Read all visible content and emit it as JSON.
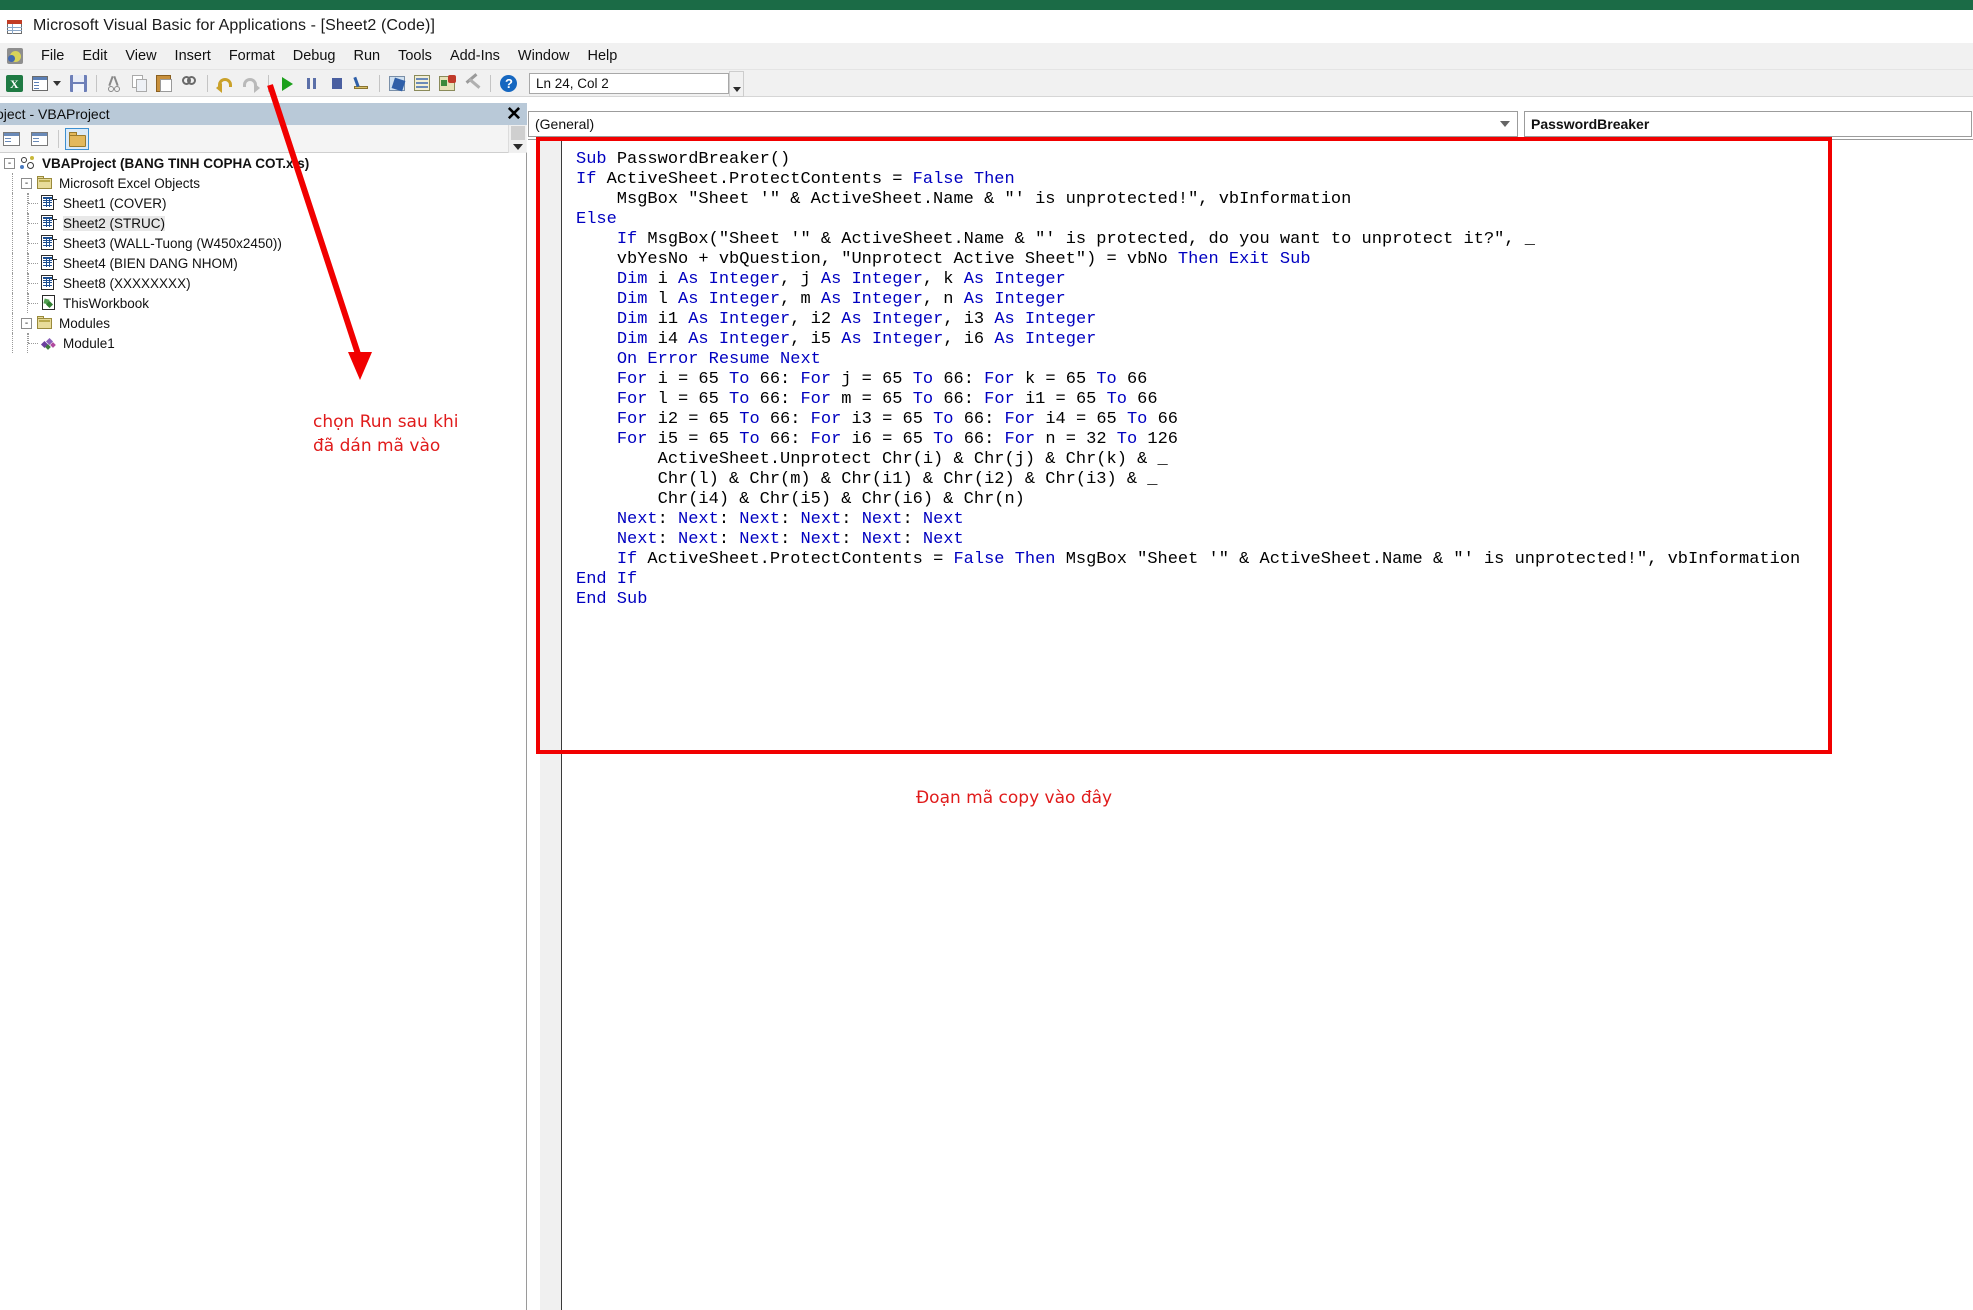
{
  "window": {
    "title": "Microsoft Visual Basic for Applications - [Sheet2 (Code)]",
    "app_icon": "excel-sheet-icon"
  },
  "menubar": {
    "items": [
      {
        "label": "File"
      },
      {
        "label": "Edit"
      },
      {
        "label": "View"
      },
      {
        "label": "Insert"
      },
      {
        "label": "Format"
      },
      {
        "label": "Debug"
      },
      {
        "label": "Run"
      },
      {
        "label": "Tools"
      },
      {
        "label": "Add-Ins"
      },
      {
        "label": "Window"
      },
      {
        "label": "Help"
      }
    ]
  },
  "toolbar": {
    "position_value": "Ln 24, Col 2",
    "buttons": [
      {
        "name": "view-excel-icon"
      },
      {
        "name": "insert-userform-icon"
      },
      {
        "name": "dropdown-arrow-icon"
      },
      {
        "name": "save-icon"
      },
      {
        "name": "cut-icon"
      },
      {
        "name": "copy-icon"
      },
      {
        "name": "paste-icon"
      },
      {
        "name": "find-icon"
      },
      {
        "name": "undo-icon"
      },
      {
        "name": "redo-icon"
      },
      {
        "name": "run-icon"
      },
      {
        "name": "break-icon"
      },
      {
        "name": "reset-icon"
      },
      {
        "name": "design-mode-icon"
      },
      {
        "name": "project-explorer-icon"
      },
      {
        "name": "properties-window-icon"
      },
      {
        "name": "object-browser-icon"
      },
      {
        "name": "toolbox-icon"
      },
      {
        "name": "help-icon"
      }
    ]
  },
  "project_explorer": {
    "title": "oject - VBAProject",
    "close_label": "✕",
    "toolbar_buttons": [
      {
        "name": "view-code-icon"
      },
      {
        "name": "view-object-icon"
      },
      {
        "name": "toggle-folders-icon"
      }
    ],
    "tree": [
      {
        "label": "VBAProject (BANG TINH COPHA COT.xls)",
        "icon": "vbaproject-icon",
        "level": 0,
        "bold": true,
        "expander": "-",
        "selected": false
      },
      {
        "label": "Microsoft Excel Objects",
        "icon": "folder-icon",
        "level": 1,
        "bold": false,
        "expander": "-",
        "selected": false
      },
      {
        "label": "Sheet1 (COVER)",
        "icon": "sheet-icon",
        "level": 2,
        "bold": false,
        "expander": "",
        "selected": false
      },
      {
        "label": "Sheet2 (STRUC)",
        "icon": "sheet-icon",
        "level": 2,
        "bold": false,
        "expander": "",
        "selected": true
      },
      {
        "label": "Sheet3 (WALL-Tuong (W450x2450))",
        "icon": "sheet-icon",
        "level": 2,
        "bold": false,
        "expander": "",
        "selected": false
      },
      {
        "label": "Sheet4 (BIEN DANG NHOM)",
        "icon": "sheet-icon",
        "level": 2,
        "bold": false,
        "expander": "",
        "selected": false
      },
      {
        "label": "Sheet8 (XXXXXXXX)",
        "icon": "sheet-icon",
        "level": 2,
        "bold": false,
        "expander": "",
        "selected": false
      },
      {
        "label": "ThisWorkbook",
        "icon": "thisworkbook-icon",
        "level": 2,
        "bold": false,
        "expander": "",
        "selected": false
      },
      {
        "label": "Modules",
        "icon": "folder-icon",
        "level": 1,
        "bold": false,
        "expander": "-",
        "selected": false
      },
      {
        "label": "Module1",
        "icon": "module-icon",
        "level": 2,
        "bold": false,
        "expander": "",
        "selected": false
      }
    ]
  },
  "code_window": {
    "object_dropdown": "(General)",
    "procedure_dropdown": "PasswordBreaker",
    "code_lines": [
      [
        {
          "t": "Sub ",
          "k": true
        },
        {
          "t": "PasswordBreaker()",
          "k": false
        }
      ],
      [
        {
          "t": "If ",
          "k": true
        },
        {
          "t": "ActiveSheet.ProtectContents = ",
          "k": false
        },
        {
          "t": "False Then",
          "k": true
        }
      ],
      [
        {
          "t": "    MsgBox \"Sheet '\" & ActiveSheet.Name & \"' is unprotected!\", vbInformation",
          "k": false
        }
      ],
      [
        {
          "t": "Else",
          "k": true
        }
      ],
      [
        {
          "t": "    ",
          "k": false
        },
        {
          "t": "If ",
          "k": true
        },
        {
          "t": "MsgBox(\"Sheet '\" & ActiveSheet.Name & \"' is protected, do you want to unprotect it?\", _",
          "k": false
        }
      ],
      [
        {
          "t": "    vbYesNo + vbQuestion, \"Unprotect Active Sheet\") = vbNo ",
          "k": false
        },
        {
          "t": "Then Exit Sub",
          "k": true
        }
      ],
      [
        {
          "t": "    ",
          "k": false
        },
        {
          "t": "Dim ",
          "k": true
        },
        {
          "t": "i ",
          "k": false
        },
        {
          "t": "As Integer",
          "k": true
        },
        {
          "t": ", j ",
          "k": false
        },
        {
          "t": "As Integer",
          "k": true
        },
        {
          "t": ", k ",
          "k": false
        },
        {
          "t": "As Integer",
          "k": true
        }
      ],
      [
        {
          "t": "    ",
          "k": false
        },
        {
          "t": "Dim ",
          "k": true
        },
        {
          "t": "l ",
          "k": false
        },
        {
          "t": "As Integer",
          "k": true
        },
        {
          "t": ", m ",
          "k": false
        },
        {
          "t": "As Integer",
          "k": true
        },
        {
          "t": ", n ",
          "k": false
        },
        {
          "t": "As Integer",
          "k": true
        }
      ],
      [
        {
          "t": "    ",
          "k": false
        },
        {
          "t": "Dim ",
          "k": true
        },
        {
          "t": "i1 ",
          "k": false
        },
        {
          "t": "As Integer",
          "k": true
        },
        {
          "t": ", i2 ",
          "k": false
        },
        {
          "t": "As Integer",
          "k": true
        },
        {
          "t": ", i3 ",
          "k": false
        },
        {
          "t": "As Integer",
          "k": true
        }
      ],
      [
        {
          "t": "    ",
          "k": false
        },
        {
          "t": "Dim ",
          "k": true
        },
        {
          "t": "i4 ",
          "k": false
        },
        {
          "t": "As Integer",
          "k": true
        },
        {
          "t": ", i5 ",
          "k": false
        },
        {
          "t": "As Integer",
          "k": true
        },
        {
          "t": ", i6 ",
          "k": false
        },
        {
          "t": "As Integer",
          "k": true
        }
      ],
      [
        {
          "t": "    ",
          "k": false
        },
        {
          "t": "On Error Resume Next",
          "k": true
        }
      ],
      [
        {
          "t": "    ",
          "k": false
        },
        {
          "t": "For ",
          "k": true
        },
        {
          "t": "i = 65 ",
          "k": false
        },
        {
          "t": "To ",
          "k": true
        },
        {
          "t": "66: ",
          "k": false
        },
        {
          "t": "For ",
          "k": true
        },
        {
          "t": "j = 65 ",
          "k": false
        },
        {
          "t": "To ",
          "k": true
        },
        {
          "t": "66: ",
          "k": false
        },
        {
          "t": "For ",
          "k": true
        },
        {
          "t": "k = 65 ",
          "k": false
        },
        {
          "t": "To ",
          "k": true
        },
        {
          "t": "66",
          "k": false
        }
      ],
      [
        {
          "t": "    ",
          "k": false
        },
        {
          "t": "For ",
          "k": true
        },
        {
          "t": "l = 65 ",
          "k": false
        },
        {
          "t": "To ",
          "k": true
        },
        {
          "t": "66: ",
          "k": false
        },
        {
          "t": "For ",
          "k": true
        },
        {
          "t": "m = 65 ",
          "k": false
        },
        {
          "t": "To ",
          "k": true
        },
        {
          "t": "66: ",
          "k": false
        },
        {
          "t": "For ",
          "k": true
        },
        {
          "t": "i1 = 65 ",
          "k": false
        },
        {
          "t": "To ",
          "k": true
        },
        {
          "t": "66",
          "k": false
        }
      ],
      [
        {
          "t": "    ",
          "k": false
        },
        {
          "t": "For ",
          "k": true
        },
        {
          "t": "i2 = 65 ",
          "k": false
        },
        {
          "t": "To ",
          "k": true
        },
        {
          "t": "66: ",
          "k": false
        },
        {
          "t": "For ",
          "k": true
        },
        {
          "t": "i3 = 65 ",
          "k": false
        },
        {
          "t": "To ",
          "k": true
        },
        {
          "t": "66: ",
          "k": false
        },
        {
          "t": "For ",
          "k": true
        },
        {
          "t": "i4 = 65 ",
          "k": false
        },
        {
          "t": "To ",
          "k": true
        },
        {
          "t": "66",
          "k": false
        }
      ],
      [
        {
          "t": "    ",
          "k": false
        },
        {
          "t": "For ",
          "k": true
        },
        {
          "t": "i5 = 65 ",
          "k": false
        },
        {
          "t": "To ",
          "k": true
        },
        {
          "t": "66: ",
          "k": false
        },
        {
          "t": "For ",
          "k": true
        },
        {
          "t": "i6 = 65 ",
          "k": false
        },
        {
          "t": "To ",
          "k": true
        },
        {
          "t": "66: ",
          "k": false
        },
        {
          "t": "For ",
          "k": true
        },
        {
          "t": "n = 32 ",
          "k": false
        },
        {
          "t": "To ",
          "k": true
        },
        {
          "t": "126",
          "k": false
        }
      ],
      [
        {
          "t": "        ActiveSheet.Unprotect Chr(i) & Chr(j) & Chr(k) & _",
          "k": false
        }
      ],
      [
        {
          "t": "        Chr(l) & Chr(m) & Chr(i1) & Chr(i2) & Chr(i3) & _",
          "k": false
        }
      ],
      [
        {
          "t": "        Chr(i4) & Chr(i5) & Chr(i6) & Chr(n)",
          "k": false
        }
      ],
      [
        {
          "t": "    ",
          "k": false
        },
        {
          "t": "Next",
          "k": true
        },
        {
          "t": ": ",
          "k": false
        },
        {
          "t": "Next",
          "k": true
        },
        {
          "t": ": ",
          "k": false
        },
        {
          "t": "Next",
          "k": true
        },
        {
          "t": ": ",
          "k": false
        },
        {
          "t": "Next",
          "k": true
        },
        {
          "t": ": ",
          "k": false
        },
        {
          "t": "Next",
          "k": true
        },
        {
          "t": ": ",
          "k": false
        },
        {
          "t": "Next",
          "k": true
        }
      ],
      [
        {
          "t": "    ",
          "k": false
        },
        {
          "t": "Next",
          "k": true
        },
        {
          "t": ": ",
          "k": false
        },
        {
          "t": "Next",
          "k": true
        },
        {
          "t": ": ",
          "k": false
        },
        {
          "t": "Next",
          "k": true
        },
        {
          "t": ": ",
          "k": false
        },
        {
          "t": "Next",
          "k": true
        },
        {
          "t": ": ",
          "k": false
        },
        {
          "t": "Next",
          "k": true
        },
        {
          "t": ": ",
          "k": false
        },
        {
          "t": "Next",
          "k": true
        }
      ],
      [
        {
          "t": "    ",
          "k": false
        },
        {
          "t": "If ",
          "k": true
        },
        {
          "t": "ActiveSheet.ProtectContents = ",
          "k": false
        },
        {
          "t": "False Then ",
          "k": true
        },
        {
          "t": "MsgBox \"Sheet '\" & ActiveSheet.Name & \"' is unprotected!\", vbInformation",
          "k": false
        }
      ],
      [
        {
          "t": "End If",
          "k": true
        }
      ],
      [
        {
          "t": "End Sub",
          "k": true
        }
      ]
    ]
  },
  "annotations": {
    "note_run": "chọn Run sau khi\nđã dán mã vào",
    "note_paste": "Đoạn mã copy vào đây",
    "arrow_color": "#f10000",
    "box_color": "#f10000",
    "text_color": "#e01b1b"
  }
}
